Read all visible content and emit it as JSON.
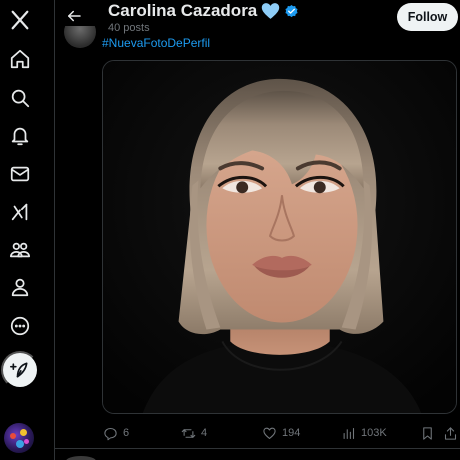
{
  "app": {
    "name": "X"
  },
  "nav": {
    "items": [
      {
        "icon": "x-logo-icon",
        "label": "X"
      },
      {
        "icon": "home-icon",
        "label": "Home"
      },
      {
        "icon": "search-icon",
        "label": "Explore"
      },
      {
        "icon": "bell-icon",
        "label": "Notifications"
      },
      {
        "icon": "mail-icon",
        "label": "Messages"
      },
      {
        "icon": "grok-icon",
        "label": "Grok"
      },
      {
        "icon": "communities-icon",
        "label": "Communities"
      },
      {
        "icon": "profile-icon",
        "label": "Profile"
      },
      {
        "icon": "more-icon",
        "label": "More"
      }
    ],
    "post_button_icon": "feather-plus-icon"
  },
  "header": {
    "display_name": "Carolina Cazadora",
    "post_count": "40 posts",
    "follow_label": "Follow",
    "heart_color": "#8ecdf7",
    "verified_color": "#1d9bf0"
  },
  "post": {
    "hashtag": "#NuevaFotoDePerfil",
    "replies": "6",
    "reposts": "4",
    "likes": "194",
    "views": "103K"
  },
  "colors": {
    "background": "#000000",
    "text_primary": "#e7e9ea",
    "text_secondary": "#71767b",
    "accent": "#1d9bf0",
    "divider": "#2f3336"
  }
}
